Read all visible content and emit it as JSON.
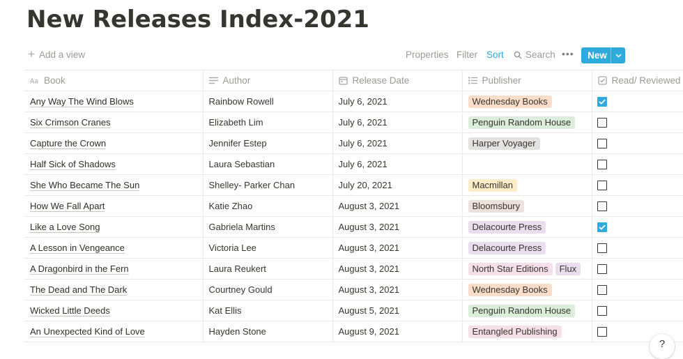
{
  "page": {
    "title": "New Releases Index-2021"
  },
  "toolbar": {
    "add_view": "Add a view",
    "properties": "Properties",
    "filter": "Filter",
    "sort": "Sort",
    "search": "Search",
    "more": "•••",
    "new": "New"
  },
  "columns": {
    "book": "Book",
    "author": "Author",
    "release_date": "Release Date",
    "publisher": "Publisher",
    "read": "Read/ Reviewed"
  },
  "tag_colors": {
    "orange": "#fadec9",
    "green": "#dbeddb",
    "gray": "#e3e2e0",
    "yellow": "#fdecc8",
    "brown": "#eee0da",
    "purple": "#e8deee",
    "pink": "#f5e0e9"
  },
  "rows": [
    {
      "book": "Any Way The Wind Blows",
      "author": "Rainbow Rowell",
      "date": "July 6, 2021",
      "publishers": [
        {
          "name": "Wednesday Books",
          "color": "orange"
        }
      ],
      "read": true
    },
    {
      "book": "Six Crimson Cranes",
      "author": "Elizabeth Lim",
      "date": "July 6, 2021",
      "publishers": [
        {
          "name": "Penguin Random House",
          "color": "green"
        }
      ],
      "read": false
    },
    {
      "book": "Capture the Crown",
      "author": "Jennifer Estep",
      "date": "July 6, 2021",
      "publishers": [
        {
          "name": "Harper Voyager",
          "color": "gray"
        }
      ],
      "read": false
    },
    {
      "book": "Half Sick of Shadows",
      "author": "Laura Sebastian",
      "date": "July 6, 2021",
      "publishers": [],
      "read": false
    },
    {
      "book": "She Who Became The Sun",
      "author": "Shelley- Parker Chan",
      "date": "July 20, 2021",
      "publishers": [
        {
          "name": "Macmillan",
          "color": "yellow"
        }
      ],
      "read": false
    },
    {
      "book": "How We Fall Apart",
      "author": "Katie Zhao",
      "date": "August 3, 2021",
      "publishers": [
        {
          "name": "Bloomsbury",
          "color": "brown"
        }
      ],
      "read": false
    },
    {
      "book": "Like a Love Song",
      "author": "Gabriela Martins",
      "date": "August 3, 2021",
      "publishers": [
        {
          "name": "Delacourte Press",
          "color": "purple"
        }
      ],
      "read": true
    },
    {
      "book": "A Lesson in Vengeance",
      "author": "Victoria Lee",
      "date": "August 3, 2021",
      "publishers": [
        {
          "name": "Delacourte Press",
          "color": "purple"
        }
      ],
      "read": false
    },
    {
      "book": "A Dragonbird in the Fern",
      "author": "Laura Reukert",
      "date": "August 3, 2021",
      "publishers": [
        {
          "name": "North Star Editions",
          "color": "pink"
        },
        {
          "name": "Flux",
          "color": "purple"
        }
      ],
      "read": false
    },
    {
      "book": "The Dead and The Dark",
      "author": "Courtney Gould",
      "date": "August 3, 2021",
      "publishers": [
        {
          "name": "Wednesday Books",
          "color": "orange"
        }
      ],
      "read": false
    },
    {
      "book": "Wicked Little Deeds",
      "author": "Kat Ellis",
      "date": "August 5, 2021",
      "publishers": [
        {
          "name": "Penguin Random House",
          "color": "green"
        }
      ],
      "read": false
    },
    {
      "book": "An Unexpected Kind of Love",
      "author": "Hayden Stone",
      "date": "August 9, 2021",
      "publishers": [
        {
          "name": "Entangled Publishing",
          "color": "pink"
        }
      ],
      "read": false
    }
  ],
  "help": {
    "label": "?"
  }
}
